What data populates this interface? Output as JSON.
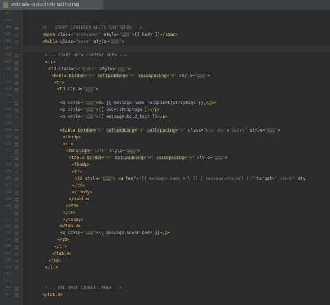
{
  "tab": {
    "label": "swiftmailer--lucius-html-mail.html.twig",
    "icon": "twig-file-icon"
  },
  "lines": [
    {
      "n": "102",
      "indent": 0,
      "tokens": []
    },
    {
      "n": "103",
      "indent": 0,
      "tokens": []
    },
    {
      "n": "104",
      "indent": 5,
      "tokens": [
        {
          "t": "<!-- START CENTERED WHITE CONTAINER -->",
          "c": "cmt"
        }
      ]
    },
    {
      "n": "105",
      "indent": 5,
      "tokens": [
        {
          "t": "<span ",
          "c": "tag"
        },
        {
          "t": "class=",
          "c": "attr"
        },
        {
          "t": "\"preheader\"",
          "c": "str"
        },
        {
          "t": " style=",
          "c": "attr"
        },
        {
          "t": "\"",
          "c": "str"
        },
        {
          "t": "...",
          "c": "ell"
        },
        {
          "t": "\"",
          "c": "str"
        },
        {
          "t": ">",
          "c": "tag"
        },
        {
          "t": "{{ body }}",
          "c": "twig"
        },
        {
          "t": "</span>",
          "c": "tag"
        }
      ]
    },
    {
      "n": "106",
      "indent": 5,
      "tokens": [
        {
          "t": "<table ",
          "c": "tag"
        },
        {
          "t": "class=",
          "c": "attr"
        },
        {
          "t": "\"main\"",
          "c": "str"
        },
        {
          "t": " style=",
          "c": "attr"
        },
        {
          "t": "\"",
          "c": "str"
        },
        {
          "t": "...",
          "c": "ell"
        },
        {
          "t": "\"",
          "c": "str"
        },
        {
          "t": ">",
          "c": "tag"
        }
      ]
    },
    {
      "n": "107",
      "indent": 0,
      "current": true,
      "tokens": []
    },
    {
      "n": "108",
      "indent": 6,
      "tokens": [
        {
          "t": "<!-- START MAIN CONTENT AREA -->",
          "c": "cmt"
        }
      ]
    },
    {
      "n": "109",
      "indent": 6,
      "tokens": [
        {
          "t": "<tr>",
          "c": "tag"
        }
      ]
    },
    {
      "n": "110",
      "indent": 7,
      "tokens": [
        {
          "t": "<td ",
          "c": "tag"
        },
        {
          "t": "class=",
          "c": "attr"
        },
        {
          "t": "\"wrapper\"",
          "c": "str"
        },
        {
          "t": " style=",
          "c": "attr"
        },
        {
          "t": "\"",
          "c": "str"
        },
        {
          "t": "...",
          "c": "ell"
        },
        {
          "t": "\"",
          "c": "str"
        },
        {
          "t": ">",
          "c": "tag"
        }
      ]
    },
    {
      "n": "111",
      "indent": 8,
      "tokens": [
        {
          "t": "<table ",
          "c": "tag"
        },
        {
          "t": "border=",
          "c": "attr-hl"
        },
        {
          "t": "\"0\"",
          "c": "str"
        },
        {
          "t": " ",
          "c": "plain"
        },
        {
          "t": "cellpadding=",
          "c": "attr-hl"
        },
        {
          "t": "\"0\"",
          "c": "str"
        },
        {
          "t": " ",
          "c": "plain"
        },
        {
          "t": "cellspacing=",
          "c": "attr-hl"
        },
        {
          "t": "\"0\"",
          "c": "str"
        },
        {
          "t": " style=",
          "c": "attr"
        },
        {
          "t": "\"",
          "c": "str"
        },
        {
          "t": "...",
          "c": "ell"
        },
        {
          "t": "\"",
          "c": "str"
        },
        {
          "t": ">",
          "c": "tag"
        }
      ]
    },
    {
      "n": "112",
      "indent": 9,
      "tokens": [
        {
          "t": "<tr>",
          "c": "tag"
        }
      ]
    },
    {
      "n": "113",
      "indent": 10,
      "tokens": [
        {
          "t": "<td ",
          "c": "tag"
        },
        {
          "t": "style=",
          "c": "attr"
        },
        {
          "t": "\"",
          "c": "str"
        },
        {
          "t": "...",
          "c": "ell"
        },
        {
          "t": "\"",
          "c": "str"
        },
        {
          "t": ">",
          "c": "tag"
        }
      ]
    },
    {
      "n": "114",
      "indent": 0,
      "tokens": []
    },
    {
      "n": "115",
      "indent": 11,
      "tokens": [
        {
          "t": "<p ",
          "c": "tag"
        },
        {
          "t": "style=",
          "c": "attr"
        },
        {
          "t": "\"",
          "c": "str"
        },
        {
          "t": "...",
          "c": "ell"
        },
        {
          "t": "\"",
          "c": "str"
        },
        {
          "t": ">",
          "c": "tag"
        },
        {
          "t": "Hi {{ message.name_recipient|striptags }},",
          "c": "twig"
        },
        {
          "t": "</p>",
          "c": "tag"
        }
      ]
    },
    {
      "n": "116",
      "indent": 11,
      "tokens": [
        {
          "t": "<p ",
          "c": "tag"
        },
        {
          "t": "style=",
          "c": "attr"
        },
        {
          "t": "\"",
          "c": "str"
        },
        {
          "t": "...",
          "c": "ell"
        },
        {
          "t": "\"",
          "c": "str"
        },
        {
          "t": ">",
          "c": "tag"
        },
        {
          "t": "{{ body|striptags }}",
          "c": "twig"
        },
        {
          "t": "</p>",
          "c": "tag"
        }
      ]
    },
    {
      "n": "117",
      "indent": 11,
      "tokens": [
        {
          "t": "<p ",
          "c": "tag"
        },
        {
          "t": "style=",
          "c": "attr"
        },
        {
          "t": "\"",
          "c": "str"
        },
        {
          "t": "...",
          "c": "ell"
        },
        {
          "t": "\"",
          "c": "str"
        },
        {
          "t": ">",
          "c": "tag"
        },
        {
          "t": "{{ message.bold_text }}",
          "c": "twig"
        },
        {
          "t": "</p>",
          "c": "tag"
        }
      ]
    },
    {
      "n": "118",
      "indent": 0,
      "tokens": []
    },
    {
      "n": "119",
      "indent": 11,
      "tokens": [
        {
          "t": "<table ",
          "c": "tag"
        },
        {
          "t": "border=",
          "c": "attr-hl"
        },
        {
          "t": "\"0\"",
          "c": "str"
        },
        {
          "t": " ",
          "c": "plain"
        },
        {
          "t": "cellpadding=",
          "c": "attr-hl"
        },
        {
          "t": "\"0\"",
          "c": "str"
        },
        {
          "t": " ",
          "c": "plain"
        },
        {
          "t": "cellspacing=",
          "c": "attr-hl"
        },
        {
          "t": "\"0\"",
          "c": "str"
        },
        {
          "t": " class=",
          "c": "attr"
        },
        {
          "t": "\"btn btn-primary\"",
          "c": "str"
        },
        {
          "t": " style=",
          "c": "attr"
        },
        {
          "t": "\"",
          "c": "str"
        },
        {
          "t": "...",
          "c": "ell"
        },
        {
          "t": "\"",
          "c": "str"
        },
        {
          "t": ">",
          "c": "tag"
        }
      ]
    },
    {
      "n": "120",
      "indent": 12,
      "tokens": [
        {
          "t": "<tbody>",
          "c": "tag"
        }
      ]
    },
    {
      "n": "121",
      "indent": 12,
      "tokens": [
        {
          "t": "<tr>",
          "c": "tag"
        }
      ]
    },
    {
      "n": "122",
      "indent": 13,
      "tokens": [
        {
          "t": "<td ",
          "c": "tag"
        },
        {
          "t": "align=",
          "c": "attr-hl"
        },
        {
          "t": "\"left\"",
          "c": "str"
        },
        {
          "t": " style=",
          "c": "attr"
        },
        {
          "t": "\"",
          "c": "str"
        },
        {
          "t": "...",
          "c": "ell"
        },
        {
          "t": "\"",
          "c": "str"
        },
        {
          "t": ">",
          "c": "tag"
        }
      ]
    },
    {
      "n": "123",
      "indent": 14,
      "tokens": [
        {
          "t": "<table ",
          "c": "tag"
        },
        {
          "t": "border=",
          "c": "attr-hl"
        },
        {
          "t": "\"0\"",
          "c": "str"
        },
        {
          "t": " ",
          "c": "plain"
        },
        {
          "t": "cellpadding=",
          "c": "attr-hl"
        },
        {
          "t": "\"0\"",
          "c": "str"
        },
        {
          "t": " ",
          "c": "plain"
        },
        {
          "t": "cellspacing=",
          "c": "attr-hl"
        },
        {
          "t": "\"0\"",
          "c": "str"
        },
        {
          "t": " style=",
          "c": "attr"
        },
        {
          "t": "\"",
          "c": "str"
        },
        {
          "t": "...",
          "c": "ell"
        },
        {
          "t": "\"",
          "c": "str"
        },
        {
          "t": ">",
          "c": "tag"
        }
      ]
    },
    {
      "n": "124",
      "indent": 15,
      "tokens": [
        {
          "t": "<tbody>",
          "c": "tag"
        }
      ]
    },
    {
      "n": "125",
      "indent": 15,
      "tokens": [
        {
          "t": "<tr>",
          "c": "tag"
        }
      ]
    },
    {
      "n": "126",
      "indent": 16,
      "tokens": [
        {
          "t": "<td ",
          "c": "tag"
        },
        {
          "t": "style=",
          "c": "attr"
        },
        {
          "t": "\"",
          "c": "str"
        },
        {
          "t": "...",
          "c": "ell"
        },
        {
          "t": "\"",
          "c": "str"
        },
        {
          "t": "> ",
          "c": "tag"
        },
        {
          "t": "<a ",
          "c": "tag"
        },
        {
          "t": "href=",
          "c": "attr"
        },
        {
          "t": "\"{{ message.base_url }}{{ message.cta_url }}\"",
          "c": "str"
        },
        {
          "t": " target=",
          "c": "attr"
        },
        {
          "t": "\"_blank\"",
          "c": "str"
        },
        {
          "t": " sty",
          "c": "attr"
        }
      ]
    },
    {
      "n": "127",
      "indent": 15,
      "tokens": [
        {
          "t": "</tr>",
          "c": "tag"
        }
      ]
    },
    {
      "n": "128",
      "indent": 15,
      "tokens": [
        {
          "t": "</tbody>",
          "c": "tag"
        }
      ]
    },
    {
      "n": "129",
      "indent": 14,
      "tokens": [
        {
          "t": "</table>",
          "c": "tag"
        }
      ]
    },
    {
      "n": "130",
      "indent": 13,
      "tokens": [
        {
          "t": "</td>",
          "c": "tag"
        }
      ]
    },
    {
      "n": "131",
      "indent": 12,
      "tokens": [
        {
          "t": "</tr>",
          "c": "tag"
        }
      ]
    },
    {
      "n": "132",
      "indent": 12,
      "tokens": [
        {
          "t": "</tbody>",
          "c": "tag"
        }
      ]
    },
    {
      "n": "133",
      "indent": 11,
      "tokens": [
        {
          "t": "</table>",
          "c": "tag"
        }
      ]
    },
    {
      "n": "134",
      "indent": 11,
      "tokens": [
        {
          "t": "<p ",
          "c": "tag"
        },
        {
          "t": "style=",
          "c": "attr"
        },
        {
          "t": "\"",
          "c": "str"
        },
        {
          "t": "...",
          "c": "ell"
        },
        {
          "t": "\"",
          "c": "str"
        },
        {
          "t": ">",
          "c": "tag"
        },
        {
          "t": "{{ message.lower_body }}",
          "c": "twig"
        },
        {
          "t": "</p>",
          "c": "tag"
        }
      ]
    },
    {
      "n": "135",
      "indent": 10,
      "tokens": [
        {
          "t": "</td>",
          "c": "tag"
        }
      ]
    },
    {
      "n": "136",
      "indent": 9,
      "tokens": [
        {
          "t": "</tr>",
          "c": "tag"
        }
      ]
    },
    {
      "n": "137",
      "indent": 8,
      "tokens": [
        {
          "t": "</table>",
          "c": "tag"
        }
      ]
    },
    {
      "n": "138",
      "indent": 7,
      "tokens": [
        {
          "t": "</td>",
          "c": "tag"
        }
      ]
    },
    {
      "n": "139",
      "indent": 6,
      "tokens": [
        {
          "t": "</tr>",
          "c": "tag"
        }
      ]
    },
    {
      "n": "140",
      "indent": 0,
      "tokens": []
    },
    {
      "n": "141",
      "indent": 0,
      "tokens": []
    },
    {
      "n": "142",
      "indent": 6,
      "tokens": [
        {
          "t": "<!-- END MAIN CONTENT AREA -->",
          "c": "cmt"
        }
      ]
    },
    {
      "n": "143",
      "indent": 5,
      "tokens": [
        {
          "t": "</table>",
          "c": "tag"
        }
      ]
    }
  ]
}
